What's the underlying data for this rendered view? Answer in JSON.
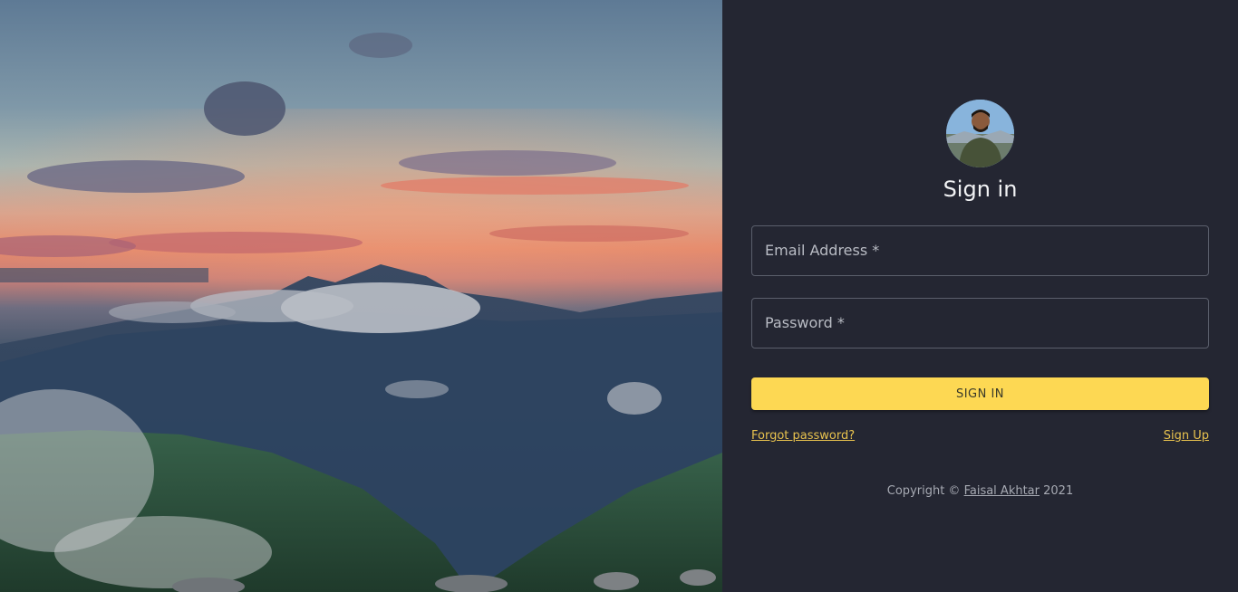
{
  "page": {
    "hero_image_alt": "",
    "accent_color": "#fdd853",
    "panel_bg": "#242632"
  },
  "form": {
    "avatar_icon": "user-avatar",
    "title": "Sign in",
    "email_label": "Email Address *",
    "password_label": "Password *",
    "submit_label": "SIGN IN",
    "forgot_label": "Forgot password?",
    "signup_label": "Sign Up"
  },
  "footer": {
    "prefix": "Copyright © ",
    "author": "Faisal Akhtar",
    "year": " 2021"
  }
}
